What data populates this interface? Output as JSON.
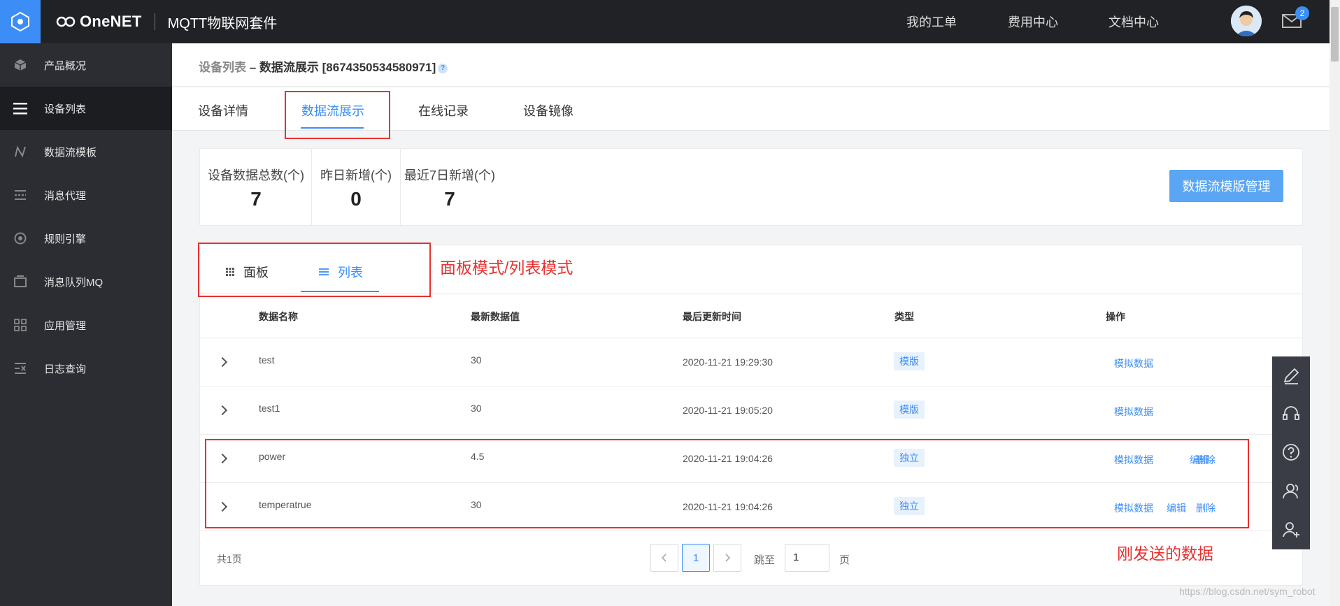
{
  "app": {
    "logo_text": "OneNET",
    "product": "MQTT物联网套件"
  },
  "topnav": [
    "我的工单",
    "费用中心",
    "文档中心"
  ],
  "mail_badge": "2",
  "sidebar": {
    "items": [
      {
        "label": "产品概况",
        "icon": "cube-icon"
      },
      {
        "label": "设备列表",
        "icon": "list-icon",
        "active": true
      },
      {
        "label": "数据流模板",
        "icon": "datastream-icon"
      },
      {
        "label": "消息代理",
        "icon": "message-proxy-icon"
      },
      {
        "label": "规则引擎",
        "icon": "rules-icon"
      },
      {
        "label": "消息队列MQ",
        "icon": "queue-icon"
      },
      {
        "label": "应用管理",
        "icon": "apps-grid-icon"
      },
      {
        "label": "日志查询",
        "icon": "log-icon"
      }
    ]
  },
  "breadcrumb": {
    "parent": "设备列表",
    "separator": " – ",
    "current": "数据流展示 [867435053458097​1]",
    "help": "?"
  },
  "tabs": [
    "设备详情",
    "数据流展示",
    "在线记录",
    "设备镜像"
  ],
  "stats": [
    {
      "label": "设备数据总数(个)",
      "value": "7"
    },
    {
      "label": "昨日新增(个)",
      "value": "0"
    },
    {
      "label": "最近7日新增(个)",
      "value": "7"
    }
  ],
  "template_button": "数据流模版管理",
  "view_modes": [
    "面板",
    "列表"
  ],
  "table": {
    "headers": [
      "数据名称",
      "最新数据值",
      "最后更新时间",
      "类型",
      "操作"
    ],
    "rows": [
      {
        "name": "test",
        "value": "30",
        "time": "2020-11-21 19:29:30",
        "type": "模版",
        "ops": [
          "模拟数据"
        ]
      },
      {
        "name": "test1",
        "value": "30",
        "time": "2020-11-21 19:05:20",
        "type": "模版",
        "ops": [
          "模拟数据"
        ]
      },
      {
        "name": "power",
        "value": "4.5",
        "time": "2020-11-21 19:04:26",
        "type": "独立",
        "ops": [
          "模拟数据",
          "编辑",
          "删除"
        ]
      },
      {
        "name": "temperatrue",
        "value": "30",
        "time": "2020-11-21 19:04:26",
        "type": "独立",
        "ops": [
          "模拟数据",
          "编辑",
          "删除"
        ]
      }
    ]
  },
  "pagination": {
    "total": "共1页",
    "current": "1",
    "jump_label": "跳至",
    "jump_value": "1",
    "page_unit": "页"
  },
  "annotations": {
    "mode_note": "面板模式/列表模式",
    "new_data_note": "刚发送的数据"
  },
  "watermark": "https://blog.csdn.net/sym_robot",
  "colors": {
    "accent": "#3c8ef6",
    "annotation": "#e8312f",
    "sidebar": "#2b2d33",
    "topbar": "#202226"
  }
}
